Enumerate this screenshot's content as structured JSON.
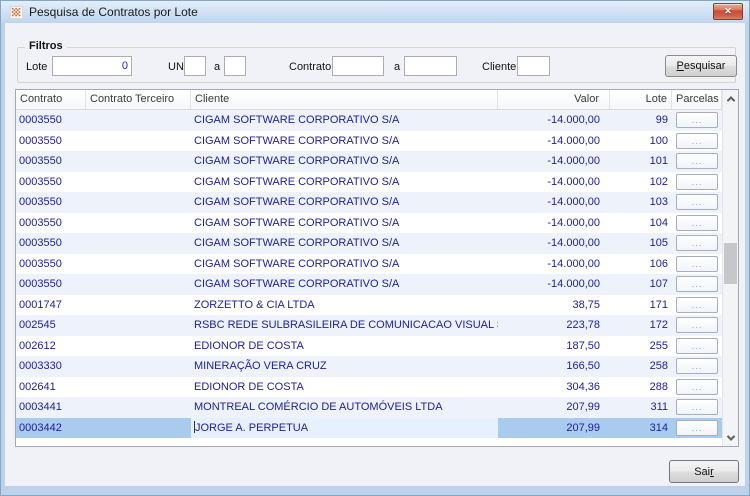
{
  "window": {
    "title": "Pesquisa de Contratos por Lote",
    "close_icon_glyph": "✕"
  },
  "filters": {
    "legend": "Filtros",
    "lote": {
      "label": "Lote",
      "value": "0"
    },
    "un": {
      "label": "UN",
      "from": "",
      "to": ""
    },
    "range_separator": "a",
    "contrato": {
      "label": "Contrato",
      "from": "",
      "to": ""
    },
    "cliente": {
      "label": "Cliente",
      "value": ""
    },
    "search_button": {
      "pre": "",
      "key": "P",
      "post": "esquisar"
    }
  },
  "grid": {
    "columns": [
      "Contrato",
      "Contrato Terceiro",
      "Cliente",
      "Valor",
      "Lote",
      "Parcelas"
    ],
    "parcelas_button_label": "...",
    "selected_row_index": 15,
    "rows": [
      {
        "contrato": "0003550",
        "contrato_terceiro": "",
        "cliente": "CIGAM SOFTWARE CORPORATIVO S/A",
        "valor": "-14.000,00",
        "lote": "99"
      },
      {
        "contrato": "0003550",
        "contrato_terceiro": "",
        "cliente": "CIGAM SOFTWARE CORPORATIVO S/A",
        "valor": "-14.000,00",
        "lote": "100"
      },
      {
        "contrato": "0003550",
        "contrato_terceiro": "",
        "cliente": "CIGAM SOFTWARE CORPORATIVO S/A",
        "valor": "-14.000,00",
        "lote": "101"
      },
      {
        "contrato": "0003550",
        "contrato_terceiro": "",
        "cliente": "CIGAM SOFTWARE CORPORATIVO S/A",
        "valor": "-14.000,00",
        "lote": "102"
      },
      {
        "contrato": "0003550",
        "contrato_terceiro": "",
        "cliente": "CIGAM SOFTWARE CORPORATIVO S/A",
        "valor": "-14.000,00",
        "lote": "103"
      },
      {
        "contrato": "0003550",
        "contrato_terceiro": "",
        "cliente": "CIGAM SOFTWARE CORPORATIVO S/A",
        "valor": "-14.000,00",
        "lote": "104"
      },
      {
        "contrato": "0003550",
        "contrato_terceiro": "",
        "cliente": "CIGAM SOFTWARE CORPORATIVO S/A",
        "valor": "-14.000,00",
        "lote": "105"
      },
      {
        "contrato": "0003550",
        "contrato_terceiro": "",
        "cliente": "CIGAM SOFTWARE CORPORATIVO S/A",
        "valor": "-14.000,00",
        "lote": "106"
      },
      {
        "contrato": "0003550",
        "contrato_terceiro": "",
        "cliente": "CIGAM SOFTWARE CORPORATIVO S/A",
        "valor": "-14.000,00",
        "lote": "107"
      },
      {
        "contrato": "0001747",
        "contrato_terceiro": "",
        "cliente": "ZORZETTO & CIA LTDA",
        "valor": "38,75",
        "lote": "171"
      },
      {
        "contrato": "002545",
        "contrato_terceiro": "",
        "cliente": "RSBC REDE SULBRASILEIRA DE COMUNICACAO VISUAL S/A",
        "valor": "223,78",
        "lote": "172"
      },
      {
        "contrato": "002612",
        "contrato_terceiro": "",
        "cliente": "EDIONOR DE COSTA",
        "valor": "187,50",
        "lote": "255"
      },
      {
        "contrato": "0003330",
        "contrato_terceiro": "",
        "cliente": "MINERAÇÃO VERA CRUZ",
        "valor": "166,50",
        "lote": "258"
      },
      {
        "contrato": "002641",
        "contrato_terceiro": "",
        "cliente": "EDIONOR DE COSTA",
        "valor": "304,36",
        "lote": "288"
      },
      {
        "contrato": "0003441",
        "contrato_terceiro": "",
        "cliente": "MONTREAL COMÉRCIO DE AUTOMÓVEIS LTDA",
        "valor": "207,99",
        "lote": "311"
      },
      {
        "contrato": "0003442",
        "contrato_terceiro": "",
        "cliente": "JORGE A. PERPETUA",
        "valor": "207,99",
        "lote": "314"
      }
    ]
  },
  "footer": {
    "exit_button": {
      "pre": "Sai",
      "key": "r",
      "post": ""
    }
  },
  "colors": {
    "grid_text": "#20209d",
    "row_alt": "#edf2fb",
    "selected_row": "#a9cbee",
    "edit_cell": "#e7f1fd",
    "titlebar_top": "#e3eefb",
    "titlebar_bottom": "#c0d5ec",
    "close_button_red": "#c64a3c",
    "app_icon_orange": "#e2612c"
  }
}
